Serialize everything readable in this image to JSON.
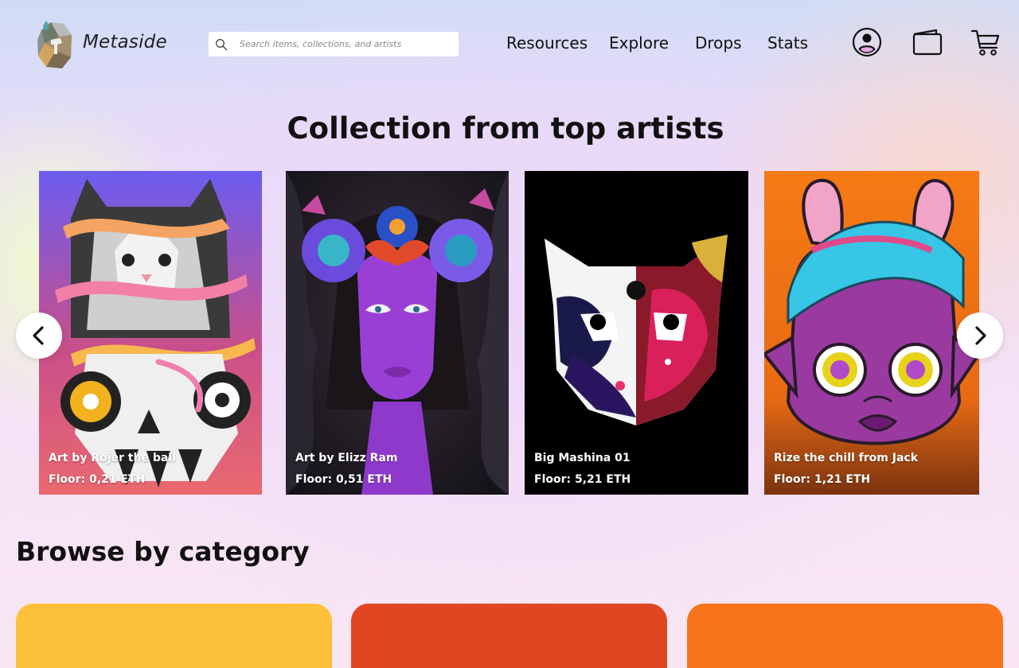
{
  "header": {
    "brand": "Metaside",
    "search": {
      "placeholder": "Search items, collections, and artists",
      "value": ""
    },
    "nav": [
      "Resources",
      "Explore",
      "Drops",
      "Stats"
    ],
    "icons": [
      "profile-icon",
      "wallet-icon",
      "cart-icon",
      "search-icon"
    ]
  },
  "carousel": {
    "title": "Collection from top artists",
    "cards": [
      {
        "title": "Art by Rojer the ball",
        "floor": "Floor: 0,21 ETH"
      },
      {
        "title": "Art by Elizz Ram",
        "floor": "Floor: 0,51 ETH"
      },
      {
        "title": "Big Mashina 01",
        "floor": "Floor: 5,21 ETH"
      },
      {
        "title": "Rize the chill from Jack",
        "floor": "Floor: 1,21 ETH"
      }
    ],
    "controls": [
      "chevron-left-icon",
      "chevron-right-icon"
    ]
  },
  "browse": {
    "title": "Browse by category",
    "tile_colors": [
      "#fdc03a",
      "#df4621",
      "#f7741b"
    ]
  },
  "colors": {
    "card1_gradient": [
      "#6b5cf0",
      "#c94f8a",
      "#e9696f"
    ],
    "card2_background": "#23202b",
    "card3_background": "#000000",
    "card4_background": "#f57a14"
  }
}
